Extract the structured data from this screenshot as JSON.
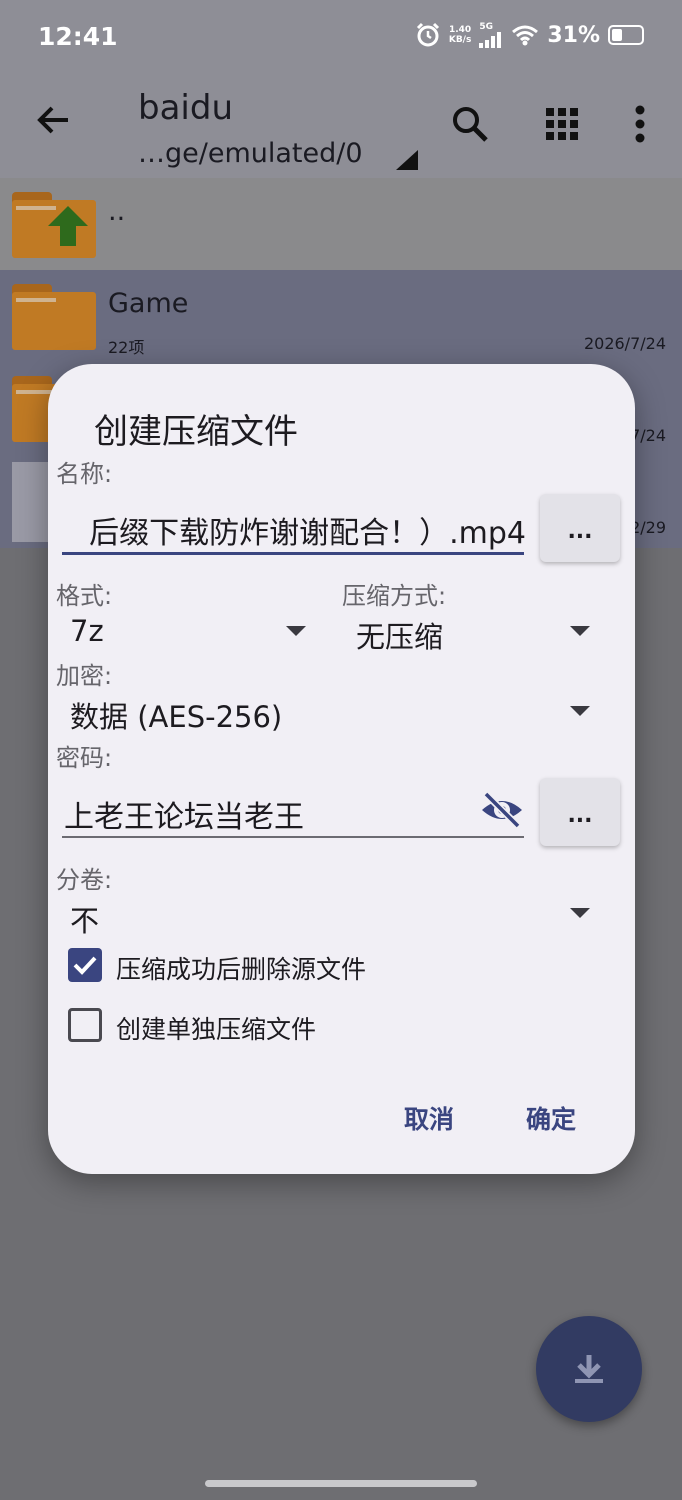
{
  "status_bar": {
    "time": "12:41",
    "net_speed_value": "1.40",
    "net_speed_unit": "KB/s",
    "network": "5G",
    "battery": "31%"
  },
  "app_bar": {
    "title": "baidu",
    "path": "…ge/emulated/0"
  },
  "files": [
    {
      "name": "..",
      "meta": "",
      "date": ""
    },
    {
      "name": "Game",
      "meta": "22项",
      "date": "2026/7/24"
    },
    {
      "name": "",
      "meta": "",
      "date": "7/24"
    },
    {
      "name": "",
      "meta": "",
      "date": "2/29"
    }
  ],
  "dialog": {
    "title": "创建压缩文件",
    "name_label": "名称:",
    "name_value": "后缀下载防炸谢谢配合！）.mp4",
    "browse_label": "...",
    "format_label": "格式:",
    "format_value": "7z",
    "method_label": "压缩方式:",
    "method_value": "无压缩",
    "encrypt_label": "加密:",
    "encrypt_value": "数据 (AES-256)",
    "password_label": "密码:",
    "password_value": "上老王论坛当老王",
    "password_more_label": "...",
    "split_label": "分卷:",
    "split_value": "不",
    "delete_source_label": "压缩成功后删除源文件",
    "delete_source_checked": true,
    "separate_archive_label": "创建单独压缩文件",
    "separate_archive_checked": false,
    "cancel_label": "取消",
    "ok_label": "确定"
  },
  "colors": {
    "accent": "#3a4580",
    "dialog_bg": "#f1eff5",
    "fab": "#323b62",
    "folder": "#c07a24"
  }
}
